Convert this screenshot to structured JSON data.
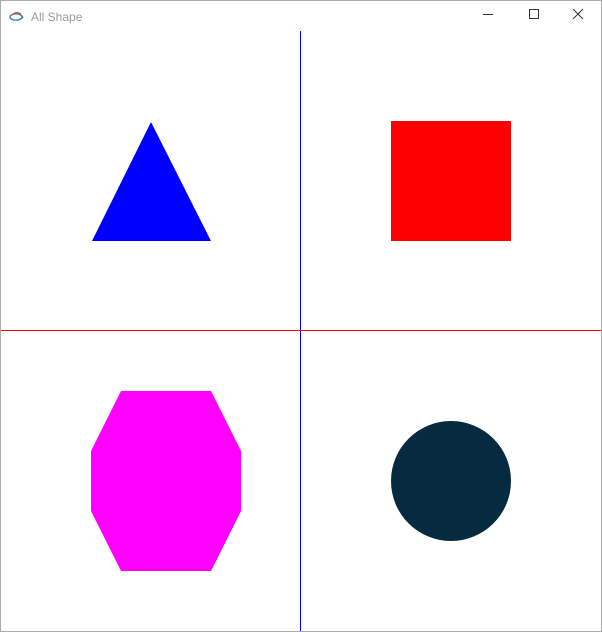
{
  "window": {
    "title": "All Shape",
    "app_icon": "java-cup-icon",
    "controls": {
      "minimize_icon": "minimize-icon",
      "maximize_icon": "maximize-icon",
      "close_icon": "close-icon"
    }
  },
  "canvas": {
    "background": "#ffffff",
    "divider_colors": {
      "vertical": "#0000ff",
      "horizontal": "#ff0000"
    },
    "shapes": [
      {
        "name": "triangle",
        "color": "#0000ff"
      },
      {
        "name": "square",
        "color": "#ff0000"
      },
      {
        "name": "octagon",
        "color": "#ff00ff"
      },
      {
        "name": "circle",
        "color": "#062b40"
      }
    ]
  }
}
